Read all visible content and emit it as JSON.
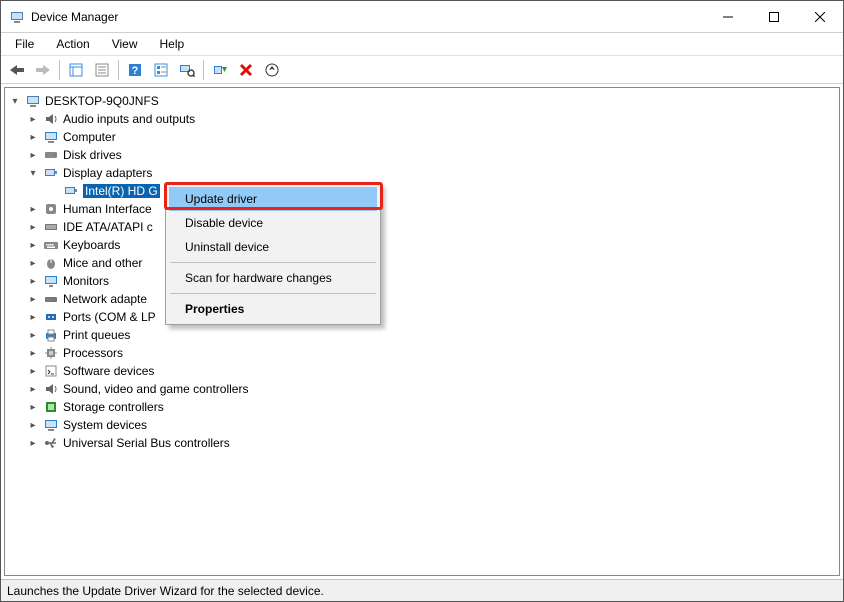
{
  "window": {
    "title": "Device Manager"
  },
  "menubar": {
    "file": "File",
    "action": "Action",
    "view": "View",
    "help": "Help"
  },
  "toolbar_icons": {
    "back": "back-arrow-icon",
    "forward": "forward-arrow-icon",
    "show": "show-hidden-icon",
    "properties": "properties-icon",
    "help": "help-icon",
    "details": "details-icon",
    "scan": "scan-hardware-icon",
    "add": "add-hardware-icon",
    "remove": "remove-icon",
    "update": "update-driver-icon"
  },
  "tree": {
    "root": "DESKTOP-9Q0JNFS",
    "nodes": {
      "audio": "Audio inputs and outputs",
      "computer": "Computer",
      "disk": "Disk drives",
      "display": "Display adapters",
      "intelhd": "Intel(R) HD G",
      "hid": "Human Interface",
      "ide": "IDE ATA/ATAPI c",
      "keyboards": "Keyboards",
      "mice": "Mice and other",
      "monitors": "Monitors",
      "network": "Network adapte",
      "ports": "Ports (COM & LP",
      "printqueues": "Print queues",
      "processors": "Processors",
      "softwaredevices": "Software devices",
      "sound": "Sound, video and game controllers",
      "storage": "Storage controllers",
      "system": "System devices",
      "usb": "Universal Serial Bus controllers"
    }
  },
  "context_menu": {
    "update_driver": "Update driver",
    "disable_device": "Disable device",
    "uninstall_device": "Uninstall device",
    "scan_hardware": "Scan for hardware changes",
    "properties": "Properties"
  },
  "statusbar": {
    "text": "Launches the Update Driver Wizard for the selected device."
  }
}
